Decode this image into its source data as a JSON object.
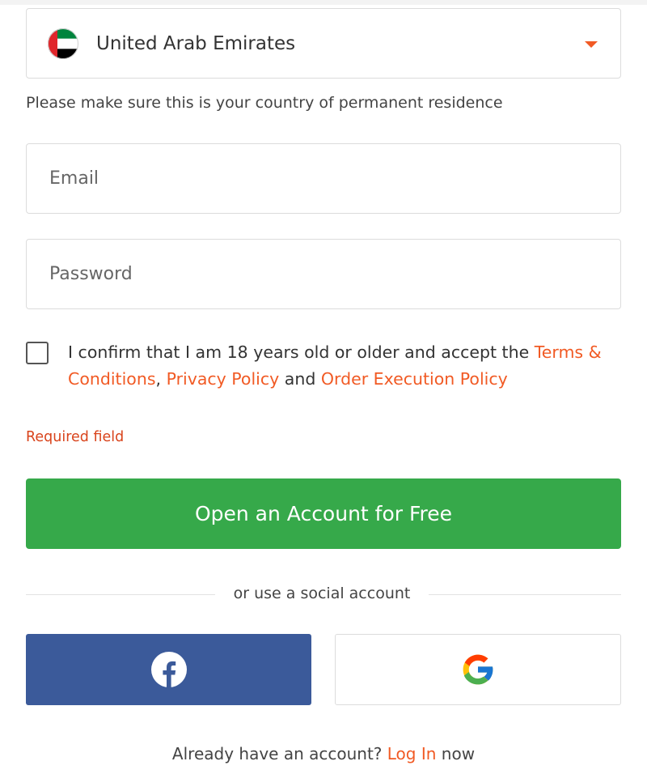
{
  "country_select": {
    "selected": "United Arab Emirates",
    "flag_icon": "uae-flag-icon",
    "caret_icon": "caret-down-icon"
  },
  "residence_hint": "Please make sure this is your country of permanent residence",
  "email": {
    "placeholder": "Email",
    "value": ""
  },
  "password": {
    "placeholder": "Password",
    "value": ""
  },
  "consent": {
    "text_before": "I confirm that I am 18 years old or older and accept the ",
    "terms_link": "Terms & Conditions",
    "comma": ", ",
    "privacy_link": "Privacy Policy",
    "and_text": " and ",
    "order_link": "Order Execution Policy",
    "checked": false
  },
  "required_error": "Required field",
  "cta_label": "Open an Account for Free",
  "divider_text": "or use a social account",
  "social": {
    "facebook_icon": "facebook-icon",
    "google_icon": "google-icon"
  },
  "footer": {
    "text_before": "Already have an account? ",
    "login_link": "Log In",
    "text_after": " now"
  },
  "colors": {
    "accent": "#f15a24",
    "cta_green": "#36a94a",
    "facebook_blue": "#3b5a9a",
    "error": "#d9441c"
  }
}
